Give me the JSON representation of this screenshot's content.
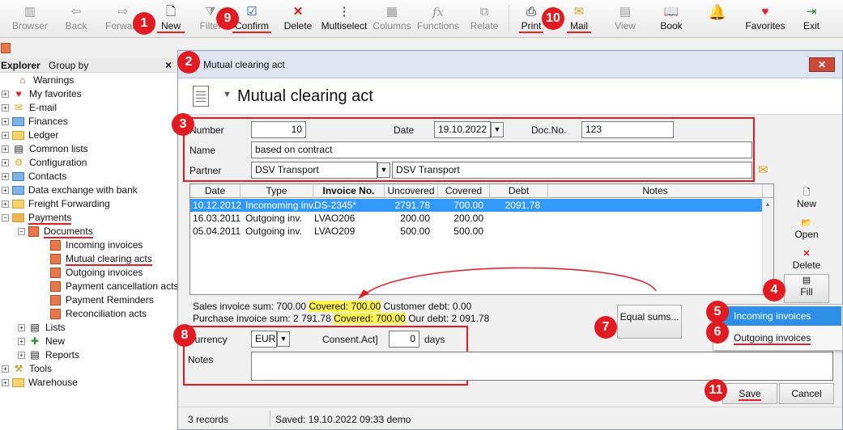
{
  "colors": {
    "accent_red": "#e11b22",
    "selection": "#3399ff",
    "highlight": "#fff44f",
    "popup_highlight": "#2d8fe6"
  },
  "toolbar": {
    "browser": "Browser",
    "back": "Back",
    "forward": "Forward",
    "new": "New",
    "filter": "Filter",
    "confirm": "Confirm",
    "delete": "Delete",
    "multiselect": "Multiselect",
    "columns": "Columns",
    "functions": "Functions",
    "relate": "Relate",
    "print": "Print",
    "mail": "Mail",
    "view": "View",
    "book": "Book",
    "favorites": "Favorites",
    "exit": "Exit"
  },
  "markers": [
    "1",
    "2",
    "3",
    "4",
    "5",
    "6",
    "7",
    "8",
    "9",
    "10",
    "11"
  ],
  "explorer": {
    "title": "Explorer",
    "group_by": "Group by",
    "close": "×",
    "items": [
      "Warnings",
      "My favorites",
      "E-mail",
      "Finances",
      "Ledger",
      "Common lists",
      "Configuration",
      "Contacts",
      "Data exchange with bank",
      "Freight Forwarding",
      "Payments",
      "Documents",
      "Incoming invoices",
      "Mutual clearing acts",
      "Outgoing invoices",
      "Payment cancellation acts",
      "Payment Reminders",
      "Reconciliation acts",
      "Lists",
      "New",
      "Reports",
      "Tools",
      "Warehouse"
    ]
  },
  "dialog": {
    "window_title": "Mutual clearing act",
    "heading": "Mutual clearing act",
    "close": "✕",
    "form": {
      "number_label": "Number",
      "number_value": "10",
      "date_label": "Date",
      "date_value": "19.10.2022",
      "docno_label": "Doc.No.",
      "docno_value": "123",
      "name_label": "Name",
      "name_value": "based on contract",
      "partner_label": "Partner",
      "partner_code": "DSV Transport",
      "partner_name": "DSV Transport"
    },
    "grid": {
      "columns": [
        "Date",
        "Type",
        "Invoice No.",
        "Uncovered",
        "Covered",
        "Debt",
        "Notes"
      ],
      "rows": [
        {
          "date": "10.12.2012",
          "type": "Incomoming inv.",
          "invoice": "DS-2345*",
          "uncovered": "2791.78",
          "covered": "700.00",
          "debt": "2091.78",
          "notes": ""
        },
        {
          "date": "16.03.2011",
          "type": "Outgoing inv.",
          "invoice": "LVAO206",
          "uncovered": "200.00",
          "covered": "200.00",
          "debt": "",
          "notes": ""
        },
        {
          "date": "05.04.2011",
          "type": "Outgoing inv.",
          "invoice": "LVAO209",
          "uncovered": "500.00",
          "covered": "500.00",
          "debt": "",
          "notes": ""
        }
      ]
    },
    "side": {
      "new": "New",
      "open": "Open",
      "delete": "Delete",
      "fill": "Fill"
    },
    "popup": {
      "incoming": "Incoming invoices",
      "outgoing": "Outgoing invoices"
    },
    "sums": {
      "sales_prefix": "Sales invoice sum: 700.00",
      "sales_covered": "Covered: 700.00",
      "sales_suffix": "Customer debt: 0.00",
      "purchase_prefix": "Purchase invoice sum: 2 791.78",
      "purchase_covered": "Covered: 700.00",
      "purchase_suffix": "Our debt: 2 091.78"
    },
    "equal_sums": "Equal sums...",
    "currency_label": "Currency",
    "currency_value": "EUR",
    "consent_label": "Consent.Act]",
    "consent_value": "0",
    "days": "days",
    "notes_label": "Notes",
    "save": "Save",
    "cancel": "Cancel",
    "status": {
      "records": "3 records",
      "saved": "Saved: 19.10.2022 09:33 demo"
    }
  }
}
